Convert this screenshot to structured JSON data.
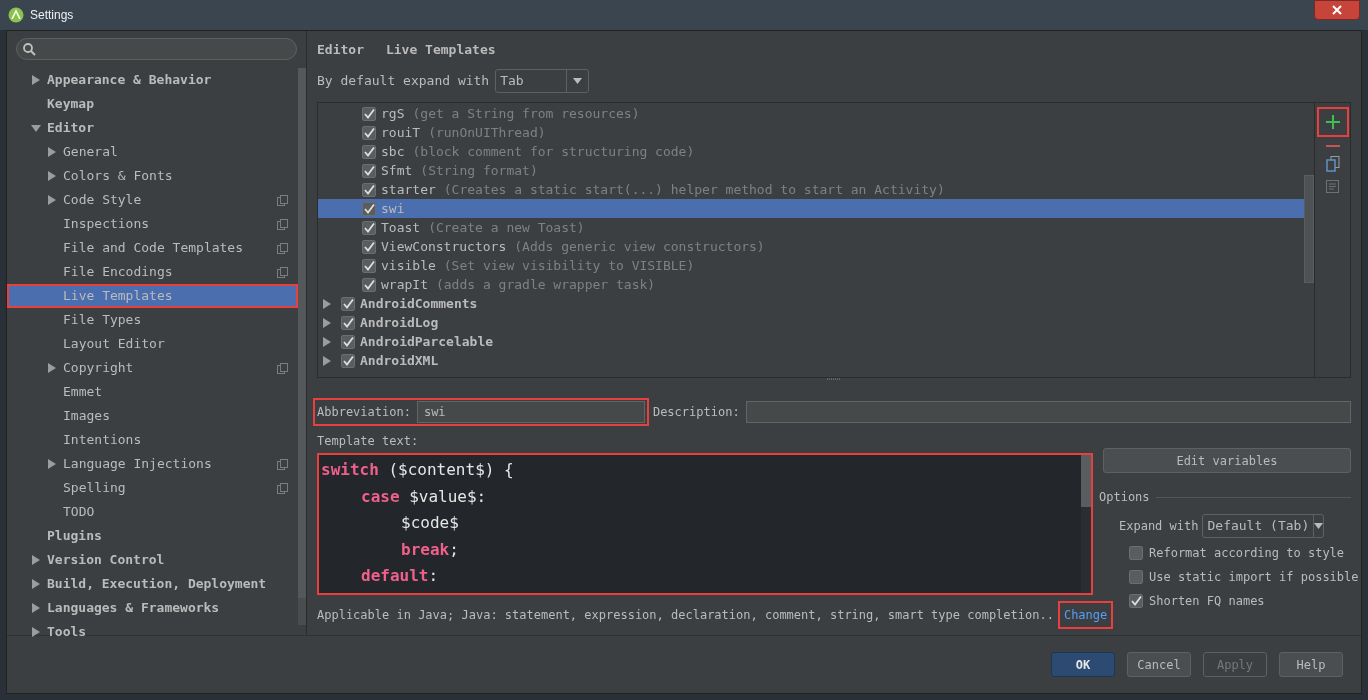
{
  "window": {
    "title": "Settings"
  },
  "sidebar": {
    "items": [
      {
        "label": "Appearance & Behavior",
        "expanded": false,
        "selected": false,
        "copy_icon": false
      },
      {
        "label": "Keymap",
        "selected": false,
        "copy_icon": false
      },
      {
        "label": "Editor",
        "expanded": true,
        "selected": false,
        "copy_icon": false,
        "children": [
          {
            "label": "General",
            "expanded": false,
            "selected": false,
            "copy_icon": false
          },
          {
            "label": "Colors & Fonts",
            "expanded": false,
            "selected": false,
            "copy_icon": false
          },
          {
            "label": "Code Style",
            "expanded": false,
            "selected": false,
            "copy_icon": true
          },
          {
            "label": "Inspections",
            "selected": false,
            "copy_icon": true
          },
          {
            "label": "File and Code Templates",
            "selected": false,
            "copy_icon": true
          },
          {
            "label": "File Encodings",
            "selected": false,
            "copy_icon": true
          },
          {
            "label": "Live Templates",
            "selected": true,
            "copy_icon": false
          },
          {
            "label": "File Types",
            "selected": false,
            "copy_icon": false
          },
          {
            "label": "Layout Editor",
            "selected": false,
            "copy_icon": false
          },
          {
            "label": "Copyright",
            "expanded": false,
            "selected": false,
            "copy_icon": true
          },
          {
            "label": "Emmet",
            "selected": false,
            "copy_icon": false
          },
          {
            "label": "Images",
            "selected": false,
            "copy_icon": false
          },
          {
            "label": "Intentions",
            "selected": false,
            "copy_icon": false
          },
          {
            "label": "Language Injections",
            "expanded": false,
            "selected": false,
            "copy_icon": true
          },
          {
            "label": "Spelling",
            "selected": false,
            "copy_icon": true
          },
          {
            "label": "TODO",
            "selected": false,
            "copy_icon": false
          }
        ]
      },
      {
        "label": "Plugins",
        "selected": false,
        "copy_icon": false
      },
      {
        "label": "Version Control",
        "expanded": false,
        "selected": false,
        "copy_icon": false
      },
      {
        "label": "Build, Execution, Deployment",
        "expanded": false,
        "selected": false,
        "copy_icon": false
      },
      {
        "label": "Languages & Frameworks",
        "expanded": false,
        "selected": false,
        "copy_icon": false
      },
      {
        "label": "Tools",
        "expanded": false,
        "selected": false,
        "copy_icon": false
      }
    ]
  },
  "breadcrumb": [
    "Editor",
    "Live Templates"
  ],
  "default_expand": {
    "label": "By default expand with",
    "value": "Tab"
  },
  "templates": [
    {
      "kind": "template",
      "abbreviation": "rgS",
      "description": "(get a String from resources)",
      "checked": true,
      "selected": false
    },
    {
      "kind": "template",
      "abbreviation": "rouiT",
      "description": "(runOnUIThread)",
      "checked": true,
      "selected": false
    },
    {
      "kind": "template",
      "abbreviation": "sbc",
      "description": "(block comment for structuring code)",
      "checked": true,
      "selected": false
    },
    {
      "kind": "template",
      "abbreviation": "Sfmt",
      "description": "(String format)",
      "checked": true,
      "selected": false
    },
    {
      "kind": "template",
      "abbreviation": "starter",
      "description": "(Creates a static start(...) helper method to start an Activity)",
      "checked": true,
      "selected": false
    },
    {
      "kind": "template",
      "abbreviation": "swi",
      "checked": true,
      "selected": true
    },
    {
      "kind": "template",
      "abbreviation": "Toast",
      "description": "(Create a new Toast)",
      "checked": true,
      "selected": false
    },
    {
      "kind": "template",
      "abbreviation": "ViewConstructors",
      "description": "(Adds generic view constructors)",
      "checked": true,
      "selected": false
    },
    {
      "kind": "template",
      "abbreviation": "visible",
      "description": "(Set view visibility to VISIBLE)",
      "checked": true,
      "selected": false
    },
    {
      "kind": "template",
      "abbreviation": "wrapIt",
      "description": "(adds a gradle wrapper task)",
      "checked": true,
      "selected": false
    },
    {
      "kind": "group",
      "abbreviation": "AndroidComments",
      "checked": true,
      "expanded": false,
      "selected": false
    },
    {
      "kind": "group",
      "abbreviation": "AndroidLog",
      "checked": true,
      "expanded": false,
      "selected": false
    },
    {
      "kind": "group",
      "abbreviation": "AndroidParcelable",
      "checked": true,
      "expanded": false,
      "selected": false
    },
    {
      "kind": "group",
      "abbreviation": "AndroidXML",
      "checked": true,
      "expanded": false,
      "selected": false
    }
  ],
  "abbreviation": {
    "label": "Abbreviation:",
    "value": "swi"
  },
  "description": {
    "label": "Description:"
  },
  "template_text": {
    "label": "Template text:",
    "lines": [
      {
        "tokens": [
          {
            "kind": "keyword",
            "text": "switch"
          },
          {
            "kind": "plain",
            "text": " ($content$) {"
          }
        ],
        "children": [
          {
            "tokens": [
              {
                "kind": "keyword",
                "text": "case"
              },
              {
                "kind": "plain",
                "text": " $value$:"
              }
            ],
            "children": [
              {
                "tokens": [
                  {
                    "kind": "plain",
                    "text": "$code$"
                  }
                ]
              },
              {
                "tokens": [
                  {
                    "kind": "keyword",
                    "text": "break"
                  },
                  {
                    "kind": "plain",
                    "text": ";"
                  }
                ]
              }
            ]
          },
          {
            "tokens": [
              {
                "kind": "keyword",
                "text": "default"
              },
              {
                "kind": "plain",
                "text": ":"
              }
            ]
          }
        ]
      }
    ]
  },
  "applicable": {
    "text": "Applicable in Java; Java: statement, expression, declaration, comment, string, smart type completion..",
    "link": "Change"
  },
  "edit_variables": "Edit variables",
  "options": {
    "title": "Options",
    "expand_with": {
      "label": "Expand with",
      "value": "Default (Tab)"
    },
    "checkboxes": [
      {
        "label": "Reformat according to style",
        "checked": false
      },
      {
        "label": "Use static import if possible",
        "checked": false
      },
      {
        "label": "Shorten FQ names",
        "checked": true
      }
    ]
  },
  "buttons": [
    {
      "label": "OK",
      "kind": "primary",
      "disabled": false
    },
    {
      "label": "Cancel",
      "kind": "normal",
      "disabled": false
    },
    {
      "label": "Apply",
      "kind": "normal",
      "disabled": true
    },
    {
      "label": "Help",
      "kind": "normal",
      "disabled": false
    }
  ]
}
